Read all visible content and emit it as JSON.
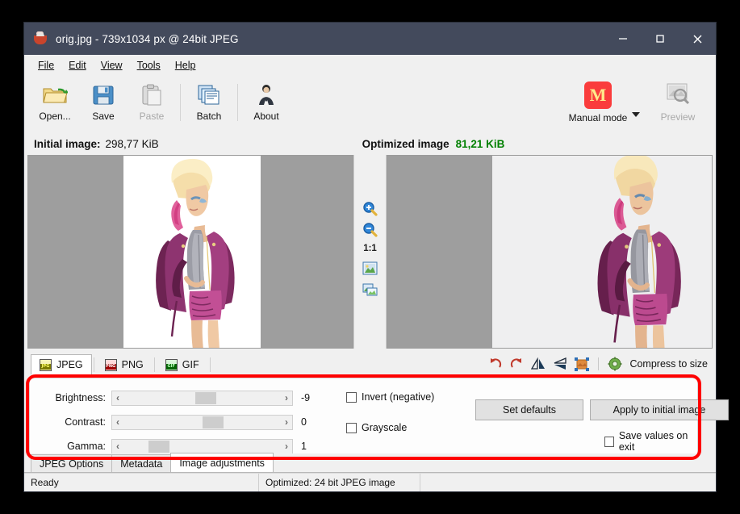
{
  "window": {
    "title": "orig.jpg - 739x1034 px @ 24bit JPEG",
    "icon": "app-cup-icon",
    "controls": {
      "minimize": "minimize-icon",
      "maximize": "maximize-icon",
      "close": "close-icon"
    }
  },
  "menubar": [
    {
      "label": "File",
      "accel": "F"
    },
    {
      "label": "Edit",
      "accel": "E"
    },
    {
      "label": "View",
      "accel": "V"
    },
    {
      "label": "Tools",
      "accel": "T"
    },
    {
      "label": "Help",
      "accel": "H"
    }
  ],
  "toolbar": {
    "buttons": [
      {
        "label": "Open...",
        "icon": "open-folder-icon",
        "enabled": true
      },
      {
        "label": "Save",
        "icon": "floppy-save-icon",
        "enabled": true
      },
      {
        "label": "Paste",
        "icon": "clipboard-paste-icon",
        "enabled": false
      },
      {
        "label": "Batch",
        "icon": "batch-files-icon",
        "enabled": true
      },
      {
        "label": "About",
        "icon": "person-about-icon",
        "enabled": true
      }
    ],
    "mode": {
      "label": "Manual mode",
      "badge": "M",
      "badge_color": "#fa3c3c",
      "dropdown": "chevron-down-icon"
    },
    "preview": {
      "label": "Preview",
      "icon": "preview-magnifier-icon",
      "enabled": false
    }
  },
  "info": {
    "initial_label": "Initial image:",
    "initial_value": "298,77 KiB",
    "optimized_label": "Optimized image",
    "optimized_value": "81,21 KiB",
    "optimized_color": "#008000"
  },
  "midbar": {
    "zoom_in": "zoom-in-icon",
    "zoom_out": "zoom-out-icon",
    "one_to_one": "1:1",
    "fit_window": "fit-to-window-icon",
    "compare": "compare-images-icon"
  },
  "format_tabs": [
    {
      "label": "JPEG",
      "icon": "jpg-file-icon",
      "tag": "JPG",
      "active": true
    },
    {
      "label": "PNG",
      "icon": "png-file-icon",
      "tag": "PNG",
      "active": false
    },
    {
      "label": "GIF",
      "icon": "gif-file-icon",
      "tag": "GIF",
      "active": false
    }
  ],
  "image_tools": [
    {
      "name": "rotate-left-icon"
    },
    {
      "name": "rotate-right-icon"
    },
    {
      "name": "flip-horizontal-icon"
    },
    {
      "name": "flip-vertical-icon"
    },
    {
      "name": "resize-crop-icon"
    }
  ],
  "compress_to_size": {
    "label": "Compress to size",
    "icon": "gear-compress-icon"
  },
  "adjustments": {
    "sliders": [
      {
        "label": "Brightness:",
        "value": "-9",
        "thumb_pct": 47,
        "dec": "‹",
        "inc": "›"
      },
      {
        "label": "Contrast:",
        "value": "0",
        "thumb_pct": 51,
        "dec": "‹",
        "inc": "›"
      },
      {
        "label": "Gamma:",
        "value": "1",
        "thumb_pct": 21,
        "dec": "‹",
        "inc": "›"
      }
    ],
    "checkboxes": [
      {
        "label": "Invert (negative)",
        "checked": false
      },
      {
        "label": "Grayscale",
        "checked": false
      }
    ],
    "buttons": [
      {
        "label": "Set defaults"
      },
      {
        "label": "Apply to initial image"
      }
    ],
    "save_on_exit": {
      "label": "Save values on exit",
      "checked": false
    },
    "highlight_color": "#ff0000"
  },
  "bottom_tabs": [
    {
      "label": "JPEG Options",
      "active": false
    },
    {
      "label": "Metadata",
      "active": false
    },
    {
      "label": "Image adjustments",
      "active": true
    }
  ],
  "statusbar": {
    "left": "Ready",
    "middle": "Optimized: 24 bit JPEG image",
    "right": ""
  }
}
